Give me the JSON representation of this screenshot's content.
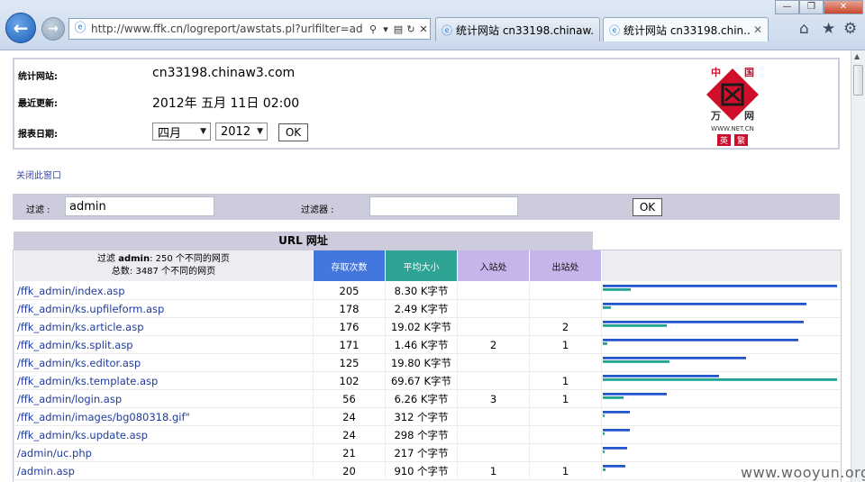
{
  "browser": {
    "url": "http://www.ffk.cn/logreport/awstats.pl?urlfilter=ad",
    "tabs": [
      {
        "title": "统计网站 cn33198.chinaw..."
      },
      {
        "title": "统计网站 cn33198.chin..."
      }
    ],
    "window_controls": {
      "minimize": "—",
      "restore": "❐",
      "close": "✕"
    }
  },
  "info": {
    "site_label": "统计网站:",
    "site_value": "cn33198.chinaw3.com",
    "update_label": "最近更新:",
    "update_value": "2012年 五月 11日 02:00",
    "date_label": "报表日期:",
    "month_selected": "四月",
    "year_selected": "2012",
    "ok_label": "OK"
  },
  "logo": {
    "top_left": "中",
    "top_right": "国",
    "bottom_left": "万",
    "bottom_right": "网",
    "url": "WWW.NET.CN",
    "chip_left": "英",
    "chip_right": "繁"
  },
  "close_window_link": "关闭此窗口",
  "filter": {
    "filter_label": "过滤 :",
    "filter_value": "admin",
    "exclude_label": "过滤器 :",
    "exclude_value": "",
    "ok_label": "OK"
  },
  "table": {
    "title": "URL 网址",
    "summary_line1_pre": "过滤",
    "summary_keyword": "admin",
    "summary_line1_post": ": 250 个不同的网页",
    "summary_line2": "总数: 3487 个不同的网页",
    "headers": {
      "hits": "存取次数",
      "size": "平均大小",
      "entry": "入站处",
      "exit": "出站处"
    },
    "max_hits": 205,
    "max_size_kb": 69.67,
    "rows": [
      {
        "url": "/ffk_admin/index.asp",
        "hits": "205",
        "size": "8.30 K字节",
        "size_kb": 8.3,
        "entry": "",
        "exit": ""
      },
      {
        "url": "/ffk_admin/ks.upfileform.asp",
        "hits": "178",
        "size": "2.49 K字节",
        "size_kb": 2.49,
        "entry": "",
        "exit": ""
      },
      {
        "url": "/ffk_admin/ks.article.asp",
        "hits": "176",
        "size": "19.02 K字节",
        "size_kb": 19.02,
        "entry": "",
        "exit": "2"
      },
      {
        "url": "/ffk_admin/ks.split.asp",
        "hits": "171",
        "size": "1.46 K字节",
        "size_kb": 1.46,
        "entry": "2",
        "exit": "1"
      },
      {
        "url": "/ffk_admin/ks.editor.asp",
        "hits": "125",
        "size": "19.80 K字节",
        "size_kb": 19.8,
        "entry": "",
        "exit": ""
      },
      {
        "url": "/ffk_admin/ks.template.asp",
        "hits": "102",
        "size": "69.67 K字节",
        "size_kb": 69.67,
        "entry": "",
        "exit": "1"
      },
      {
        "url": "/ffk_admin/login.asp",
        "hits": "56",
        "size": "6.26 K字节",
        "size_kb": 6.26,
        "entry": "3",
        "exit": "1"
      },
      {
        "url": "/ffk_admin/images/bg080318.gif\"",
        "hits": "24",
        "size": "312 个字节",
        "size_kb": 0.3,
        "entry": "",
        "exit": ""
      },
      {
        "url": "/ffk_admin/ks.update.asp",
        "hits": "24",
        "size": "298 个字节",
        "size_kb": 0.29,
        "entry": "",
        "exit": ""
      },
      {
        "url": "/admin/uc.php",
        "hits": "21",
        "size": "217 个字节",
        "size_kb": 0.21,
        "entry": "",
        "exit": ""
      },
      {
        "url": "/admin.asp",
        "hits": "20",
        "size": "910 个字节",
        "size_kb": 0.89,
        "entry": "1",
        "exit": "1"
      }
    ]
  },
  "watermark": "www.wooyun.org",
  "colors": {
    "hits_header": "#4477dd",
    "size_header": "#2ea495",
    "entry_exit_header": "#c5b5ea",
    "panel_bg": "#ccccdd",
    "link": "#1f3b9a"
  }
}
